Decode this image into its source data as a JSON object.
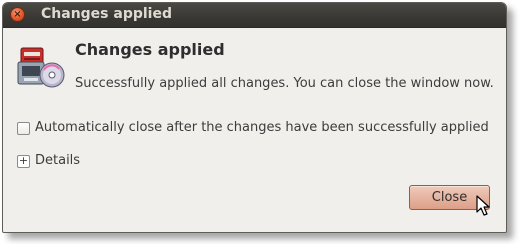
{
  "window": {
    "title": "Changes applied",
    "close_icon": "close-icon"
  },
  "content": {
    "app_icon": "package-installer-icon",
    "heading": "Changes applied",
    "message": "Successfully applied all changes. You can close the window now.",
    "auto_close_label": "Automatically close after the changes have been successfully applied",
    "auto_close_checked": false,
    "details_label": "Details",
    "details_expanded": false
  },
  "footer": {
    "close_label": "Close"
  },
  "colors": {
    "titlebar": "#3c3b37",
    "window_bg": "#f1efec",
    "close_accent": "#e2572a",
    "button_accent": "#dc9f88"
  }
}
